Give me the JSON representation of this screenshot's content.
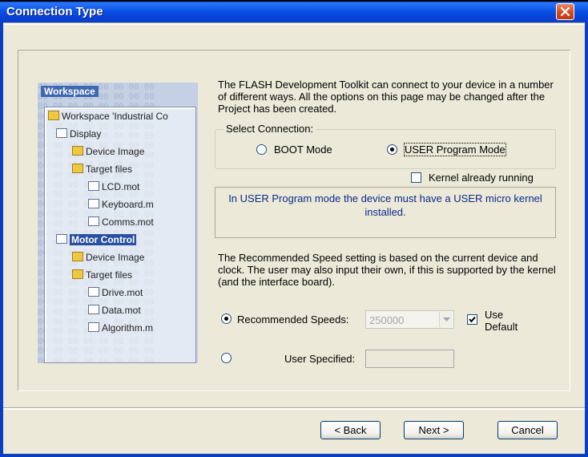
{
  "window": {
    "title": "Connection Type"
  },
  "illustration": {
    "workspace_title": "Workspace",
    "tree": [
      {
        "label": "Workspace 'Industrial Co",
        "kind": "root"
      },
      {
        "label": "Display",
        "kind": "project"
      },
      {
        "label": "Device Image",
        "kind": "folder"
      },
      {
        "label": "Target files",
        "kind": "folder"
      },
      {
        "label": "LCD.mot",
        "kind": "file"
      },
      {
        "label": "Keyboard.m",
        "kind": "file"
      },
      {
        "label": "Comms.mot",
        "kind": "file"
      },
      {
        "label": "Motor Control",
        "kind": "project"
      },
      {
        "label": "Device Image",
        "kind": "folder"
      },
      {
        "label": "Target files",
        "kind": "folder"
      },
      {
        "label": "Drive.mot",
        "kind": "file"
      },
      {
        "label": "Data.mot",
        "kind": "file"
      },
      {
        "label": "Algorithm.m",
        "kind": "file"
      }
    ]
  },
  "intro_text": "The FLASH Development Toolkit can connect to your device in a number of different ways. All the options on this page may be changed after the Project has been created.",
  "select_connection": {
    "legend": "Select Connection:",
    "options": [
      {
        "label": "BOOT Mode",
        "checked": false
      },
      {
        "label": "USER Program Mode",
        "checked": true
      }
    ]
  },
  "kernel_running": {
    "label": "Kernel already running",
    "checked": false
  },
  "info_text": "In USER Program mode the device must have a USER micro kernel installed.",
  "speed_text": "The Recommended Speed setting is based on the current device and clock. The user may also input their own, if this is supported by the kernel (and the interface board).",
  "recommended_speeds": {
    "label": "Recommended Speeds:",
    "checked": true,
    "value": "250000"
  },
  "use_default": {
    "label": "Use Default",
    "checked": true
  },
  "user_specified": {
    "label": "User Specified:",
    "checked": false,
    "value": ""
  },
  "buttons": {
    "back": "< Back",
    "next": "Next >",
    "cancel": "Cancel"
  },
  "colors": {
    "titlebar": "#0a52e4",
    "client_bg": "#ece9d8",
    "info_text": "#0b2a8a",
    "close_button": "#d14a1e"
  }
}
